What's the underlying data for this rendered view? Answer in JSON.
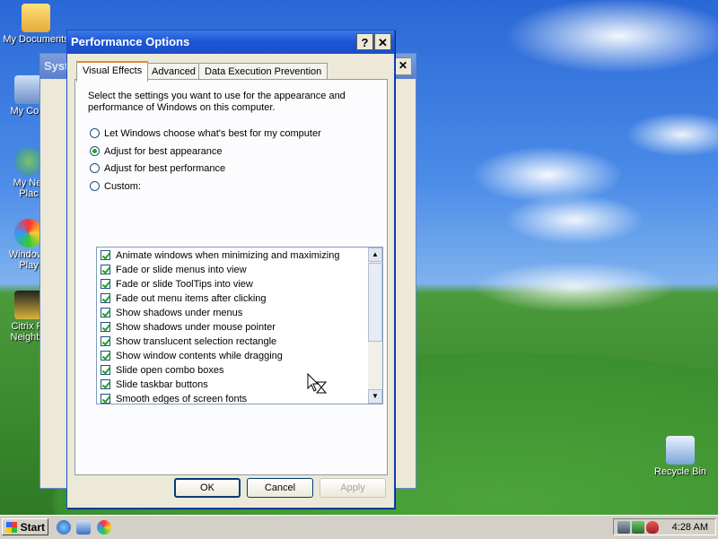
{
  "desktop": {
    "icons": [
      {
        "label": "My Documents"
      },
      {
        "label": "My Com"
      },
      {
        "label": "My Net\nPlac"
      },
      {
        "label": "Windows\nPlay"
      },
      {
        "label": "Citrix Pr\nNeighbo"
      },
      {
        "label": "Recycle Bin"
      }
    ]
  },
  "background_window": {
    "title": "Syst",
    "close_label": "✕"
  },
  "dialog": {
    "title": "Performance Options",
    "help_label": "?",
    "close_label": "✕",
    "tabs": [
      {
        "label": "Visual Effects",
        "active": true
      },
      {
        "label": "Advanced",
        "active": false
      },
      {
        "label": "Data Execution Prevention",
        "active": false
      }
    ],
    "intro": "Select the settings you want to use for the appearance and performance of Windows on this computer.",
    "options": [
      {
        "label": "Let Windows choose what's best for my computer",
        "selected": false
      },
      {
        "label": "Adjust for best appearance",
        "selected": true
      },
      {
        "label": "Adjust for best performance",
        "selected": false
      },
      {
        "label": "Custom:",
        "selected": false
      }
    ],
    "effects": [
      "Animate windows when minimizing and maximizing",
      "Fade or slide menus into view",
      "Fade or slide ToolTips into view",
      "Fade out menu items after clicking",
      "Show shadows under menus",
      "Show shadows under mouse pointer",
      "Show translucent selection rectangle",
      "Show window contents while dragging",
      "Slide open combo boxes",
      "Slide taskbar buttons",
      "Smooth edges of screen fonts"
    ],
    "buttons": {
      "ok": "OK",
      "cancel": "Cancel",
      "apply": "Apply"
    }
  },
  "taskbar": {
    "start_label": "Start",
    "clock": "4:28 AM"
  },
  "colors": {
    "title_bar": "#1c55d5",
    "check": "#21a121",
    "tab_highlight": "#e68b2c"
  }
}
